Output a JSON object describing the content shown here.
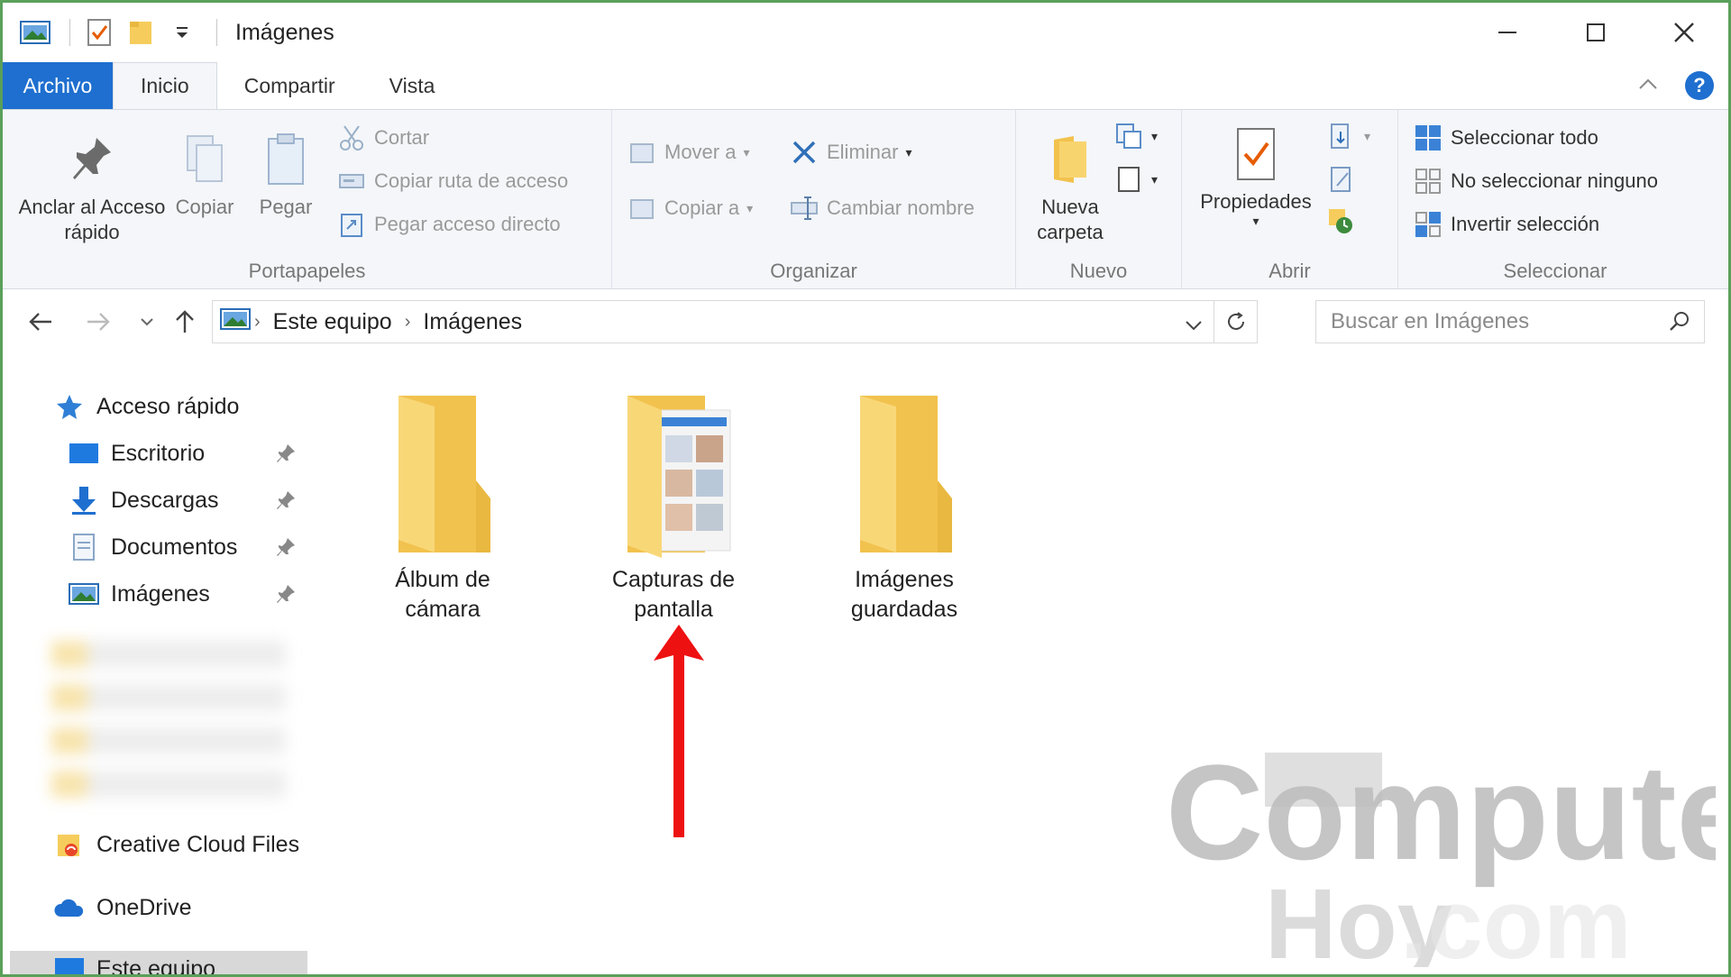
{
  "window": {
    "title": "Imágenes",
    "accent": "#1e6fcf"
  },
  "tabs": [
    {
      "label": "Archivo"
    },
    {
      "label": "Inicio"
    },
    {
      "label": "Compartir"
    },
    {
      "label": "Vista"
    }
  ],
  "ribbon": {
    "portapapeles": {
      "label": "Portapapeles",
      "pin": "Anclar al Acceso rápido",
      "copy": "Copiar",
      "paste": "Pegar",
      "cut": "Cortar",
      "copy_path": "Copiar ruta de acceso",
      "paste_shortcut": "Pegar acceso directo"
    },
    "organizar": {
      "label": "Organizar",
      "move_to": "Mover a",
      "copy_to": "Copiar a",
      "delete": "Eliminar",
      "rename": "Cambiar nombre"
    },
    "nuevo": {
      "label": "Nuevo",
      "new_folder": "Nueva carpeta"
    },
    "abrir": {
      "label": "Abrir",
      "properties": "Propiedades"
    },
    "seleccionar": {
      "label": "Seleccionar",
      "select_all": "Seleccionar todo",
      "select_none": "No seleccionar ninguno",
      "invert": "Invertir selección"
    }
  },
  "address": {
    "crumbs": [
      "Este equipo",
      "Imágenes"
    ],
    "search_placeholder": "Buscar en Imágenes"
  },
  "sidebar": {
    "quick_access": "Acceso rápido",
    "items": [
      {
        "label": "Escritorio",
        "icon": "desktop-icon"
      },
      {
        "label": "Descargas",
        "icon": "download-icon"
      },
      {
        "label": "Documentos",
        "icon": "documents-icon"
      },
      {
        "label": "Imágenes",
        "icon": "pictures-icon"
      }
    ],
    "creative_cloud": "Creative Cloud Files",
    "onedrive": "OneDrive",
    "this_pc": "Este equipo"
  },
  "folders": [
    {
      "line1": "Álbum de",
      "line2": "cámara"
    },
    {
      "line1": "Capturas de",
      "line2": "pantalla"
    },
    {
      "line1": "Imágenes",
      "line2": "guardadas"
    }
  ],
  "watermark": {
    "brand": "Computer",
    "sub": "Hoy",
    "tld": ".com"
  }
}
